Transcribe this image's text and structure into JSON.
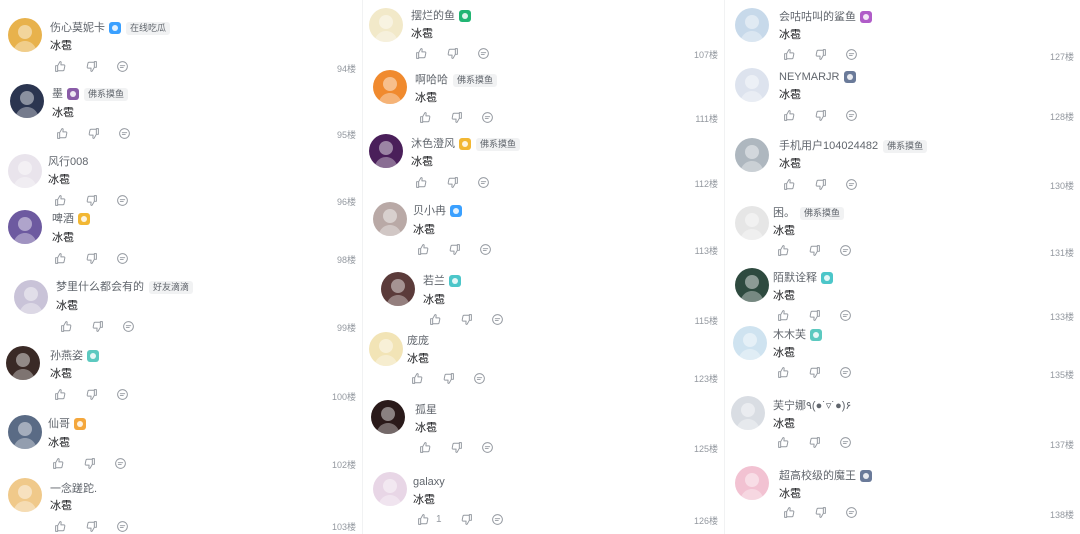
{
  "columns": [
    {
      "replies": [
        {
          "user": "伤心莫妮卡",
          "content": "冰雹",
          "tag": "在线吃瓜",
          "floor": "94楼",
          "lvColor": "#3aa0ff",
          "avatarColor": "#e8b24c"
        },
        {
          "user": "墨",
          "content": "冰雹",
          "tag": "佛系摸鱼",
          "floor": "95楼",
          "lvColor": "#8a5ca8",
          "avatarColor": "#2b3550"
        },
        {
          "user": "风行008",
          "content": "冰雹",
          "tag": "",
          "floor": "96楼",
          "lvColor": "",
          "avatarColor": "#e9e4ec"
        },
        {
          "user": "啤酒",
          "content": "冰雹",
          "tag": "",
          "floor": "98楼",
          "lvColor": "#f2b733",
          "avatarColor": "#6d5aa0"
        },
        {
          "user": "梦里什么都会有的",
          "content": "冰雹",
          "tag": "好友滴滴",
          "floor": "99楼",
          "lvColor": "",
          "avatarColor": "#c9c3d8"
        },
        {
          "user": "孙燕姿",
          "content": "冰雹",
          "tag": "",
          "floor": "100楼",
          "lvColor": "#5cc9c0",
          "avatarColor": "#3a2a26"
        },
        {
          "user": "仙哥",
          "content": "冰雹",
          "tag": "",
          "floor": "102楼",
          "lvColor": "#f4a73c",
          "avatarColor": "#5a6b85"
        },
        {
          "user": "一念蹉跎.",
          "content": "冰雹",
          "tag": "",
          "floor": "103楼",
          "lvColor": "",
          "avatarColor": "#f0c98a"
        }
      ]
    },
    {
      "replies": [
        {
          "user": "摆烂的鱼",
          "content": "冰雹",
          "tag": "",
          "floor": "107楼",
          "lvColor": "#22b573",
          "avatarColor": "#f2e9c9"
        },
        {
          "user": "啊哈哈",
          "content": "冰雹",
          "tag": "佛系摸鱼",
          "floor": "111楼",
          "lvColor": "",
          "avatarColor": "#f08a2e"
        },
        {
          "user": "沐色澄风",
          "content": "冰雹",
          "tag": "佛系摸鱼",
          "floor": "112楼",
          "lvColor": "#f2b733",
          "avatarColor": "#4a1f5a"
        },
        {
          "user": "贝小冉",
          "content": "冰雹",
          "tag": "",
          "floor": "113楼",
          "lvColor": "#3aa0ff",
          "avatarColor": "#b9a9a6"
        },
        {
          "user": "若兰",
          "content": "冰雹",
          "tag": "",
          "floor": "115楼",
          "lvColor": "#4cc6c9",
          "avatarColor": "#5b3b3a"
        },
        {
          "user": "庞庞",
          "content": "冰雹",
          "tag": "",
          "floor": "123楼",
          "lvColor": "",
          "avatarColor": "#f2e4b6"
        },
        {
          "user": "孤星",
          "content": "冰雹",
          "tag": "",
          "floor": "125楼",
          "lvColor": "",
          "avatarColor": "#2a1a1a"
        },
        {
          "user": "galaxy",
          "content": "冰雹",
          "tag": "",
          "floor": "126楼",
          "lvColor": "",
          "avatarColor": "#e8d6e6",
          "likes": "1"
        }
      ]
    },
    {
      "replies": [
        {
          "user": "会咕咕叫的鲨鱼",
          "content": "冰雹",
          "tag": "",
          "floor": "127楼",
          "lvColor": "#b05cc8",
          "avatarColor": "#c7d9ea"
        },
        {
          "user": "NEYMARJR",
          "content": "冰雹",
          "tag": "",
          "floor": "128楼",
          "lvColor": "#6a7a99",
          "avatarColor": "#dde3ee"
        },
        {
          "user": "手机用户104024482",
          "content": "冰雹",
          "tag": "佛系摸鱼",
          "floor": "130楼",
          "lvColor": "",
          "avatarColor": "#aeb7bf"
        },
        {
          "user": "困。",
          "content": "冰雹",
          "tag": "佛系摸鱼",
          "floor": "131楼",
          "lvColor": "",
          "avatarColor": "#e6e6e6"
        },
        {
          "user": "陌默诠释",
          "content": "冰雹",
          "tag": "",
          "floor": "133楼",
          "lvColor": "#4cc6c9",
          "avatarColor": "#2e4a3f"
        },
        {
          "user": "木木芙",
          "content": "冰雹",
          "tag": "",
          "floor": "135楼",
          "lvColor": "#5cc9c0",
          "avatarColor": "#cfe3f0"
        },
        {
          "user": "芙宁娜٩(●˙▿˙●)۶",
          "content": "冰雹",
          "tag": "",
          "floor": "137楼",
          "lvColor": "",
          "avatarColor": "#d9dde3"
        },
        {
          "user": "超高校级的魔王",
          "content": "冰雹",
          "tag": "",
          "floor": "138楼",
          "lvColor": "#6a7a99",
          "avatarColor": "#f2c2d2"
        }
      ]
    }
  ]
}
